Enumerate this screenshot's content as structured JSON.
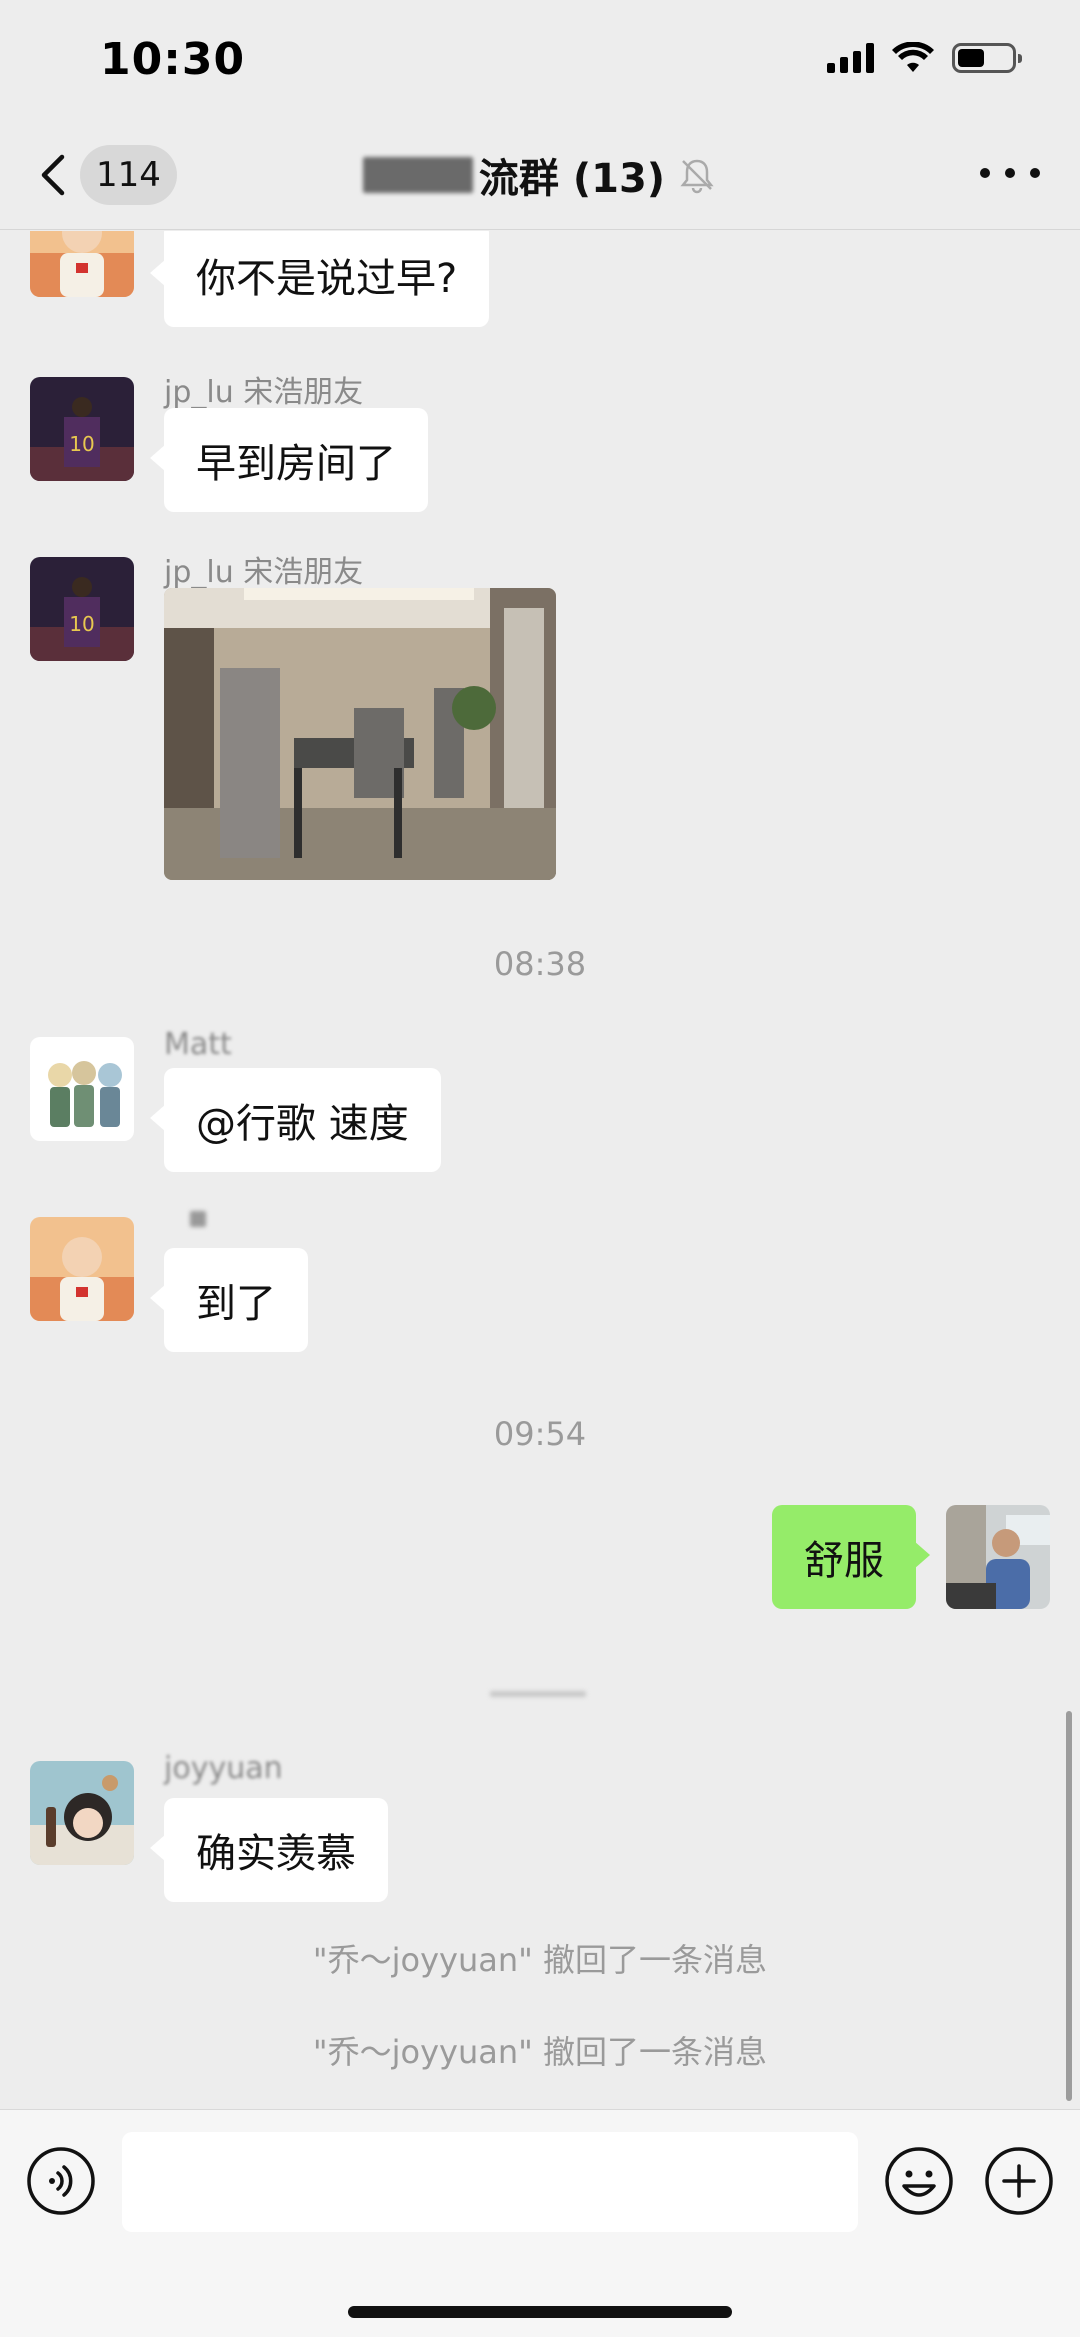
{
  "status_bar": {
    "time": "10:30",
    "battery_level": 0.45
  },
  "nav": {
    "unread_count": "114",
    "title_visible": "流群 (13)",
    "icons": {
      "back": "chevron-left-icon",
      "mute": "bell-slash-icon",
      "more": "ellipsis-icon"
    }
  },
  "messages": [
    {
      "sender": "",
      "text": "你不是说过早?"
    },
    {
      "sender": "jp_lu 宋浩朋友",
      "text": "早到房间了"
    },
    {
      "sender": "jp_lu 宋浩朋友",
      "image": "conference-room-photo"
    },
    {
      "time": "08:38"
    },
    {
      "sender": "Matt",
      "text": "@行歌 速度"
    },
    {
      "sender": "",
      "text": "到了"
    },
    {
      "time": "09:54"
    },
    {
      "sender": "me",
      "text": "舒服"
    },
    {
      "sender": "joyyuan",
      "text": "确实羡慕"
    },
    {
      "system": "\"乔～joyyuan\" 撤回了一条消息"
    },
    {
      "system": "\"乔～joyyuan\" 撤回了一条消息"
    }
  ],
  "labels": {
    "m0_text": "你不是说过早?",
    "m1_sender": "jp_lu 宋浩朋友",
    "m1_text": "早到房间了",
    "m2_sender": "jp_lu 宋浩朋友",
    "t1": "08:38",
    "m3_sender": "Matt",
    "m3_text": "@行歌 速度",
    "m4_text": "到了",
    "t2": "09:54",
    "m5_text": "舒服",
    "m6_sender": "joyyuan",
    "m6_text": "确实羡慕",
    "sys1": "\"乔～joyyuan\" 撤回了一条消息",
    "sys2": "\"乔～joyyuan\" 撤回了一条消息"
  },
  "input_bar": {
    "icons": {
      "voice": "voice-icon",
      "emoji": "emoji-icon",
      "plus": "plus-icon"
    }
  }
}
